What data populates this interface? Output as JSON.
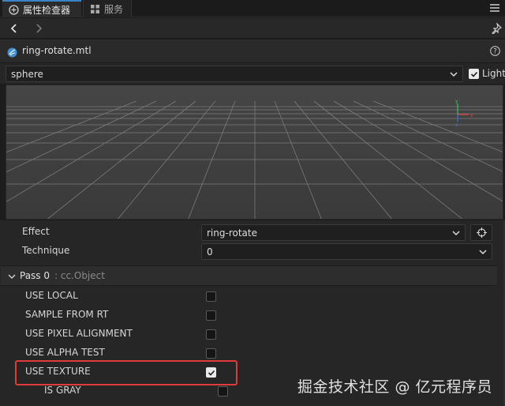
{
  "tabs": [
    {
      "label": "属性检查器",
      "icon": "inspector-icon",
      "active": true
    },
    {
      "label": "服务",
      "icon": "services-icon",
      "active": false
    }
  ],
  "asset": {
    "name": "ring-rotate.mtl",
    "icon": "material-icon"
  },
  "preview": {
    "model_select": "sphere",
    "light_label": "Light",
    "light_checked": true
  },
  "effect": {
    "label": "Effect",
    "value": "ring-rotate"
  },
  "technique": {
    "label": "Technique",
    "value": "0"
  },
  "pass": {
    "title": "Pass 0",
    "subtitle": ": cc.Object"
  },
  "defines": [
    {
      "label": "USE LOCAL",
      "checked": false
    },
    {
      "label": "SAMPLE FROM RT",
      "checked": false
    },
    {
      "label": "USE PIXEL ALIGNMENT",
      "checked": false
    },
    {
      "label": "USE ALPHA TEST",
      "checked": false
    },
    {
      "label": "USE TEXTURE",
      "checked": true
    },
    {
      "label": "IS GRAY",
      "checked": false
    }
  ],
  "watermark": "掘金技术社区 @ 亿元程序员",
  "colors": {
    "accent": "#3b83c9",
    "highlight": "#e03b3b"
  }
}
